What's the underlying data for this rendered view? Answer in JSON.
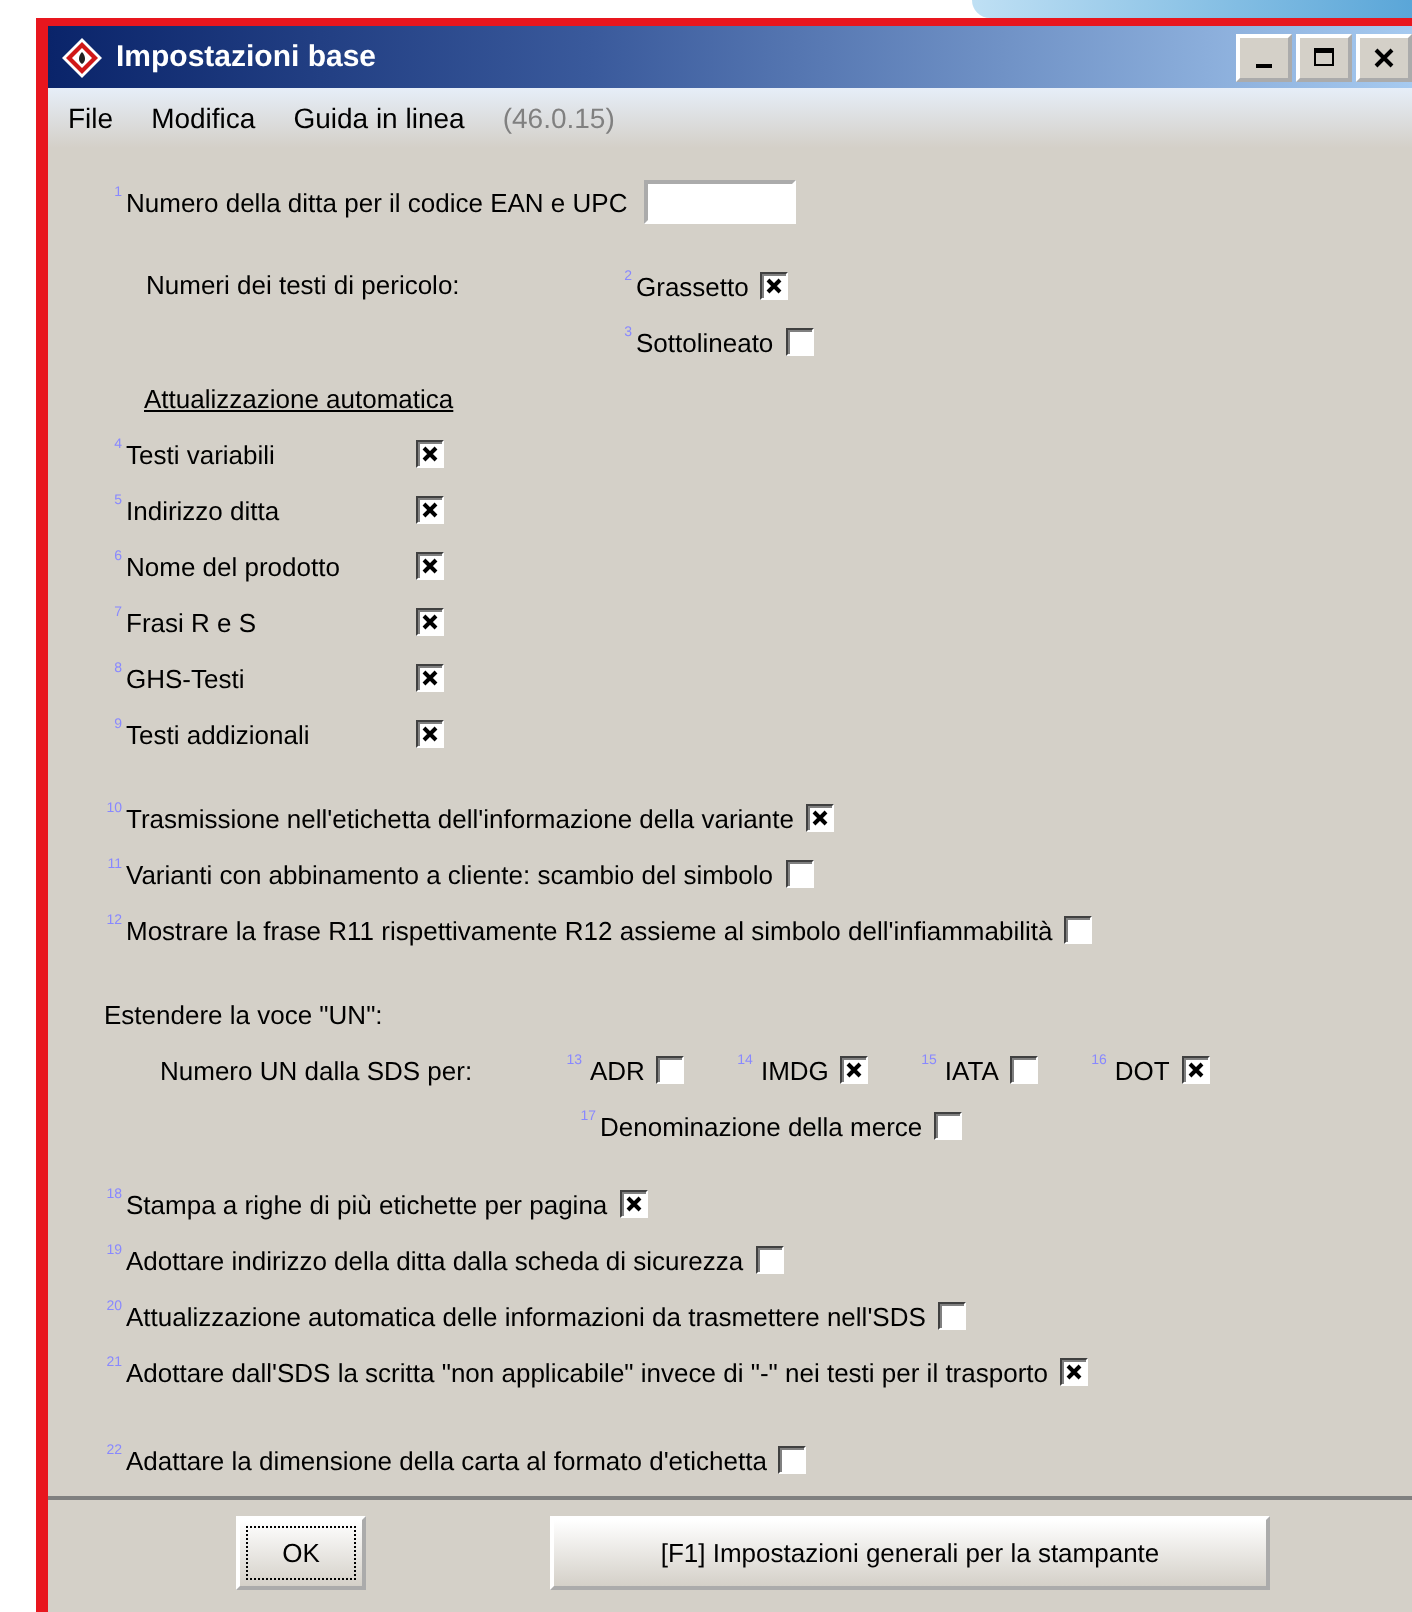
{
  "window": {
    "title": "Impostazioni base"
  },
  "menu": [
    {
      "label": "File"
    },
    {
      "label": "Modifica"
    },
    {
      "label": "Guida in linea"
    }
  ],
  "version": "(46.0.15)",
  "ean": {
    "index": "1",
    "label": "Numero della ditta per il codice EAN e UPC"
  },
  "hazard": {
    "label": "Numeri dei testi di pericolo:",
    "options": [
      {
        "index": "2",
        "label": "Grassetto",
        "checked": true
      },
      {
        "index": "3",
        "label": "Sottolineato",
        "checked": false
      }
    ]
  },
  "auto_update": {
    "heading": "Attualizzazione automatica",
    "items": [
      {
        "index": "4",
        "label": "Testi variabili",
        "checked": true
      },
      {
        "index": "5",
        "label": "Indirizzo ditta",
        "checked": true
      },
      {
        "index": "6",
        "label": "Nome del prodotto",
        "checked": true
      },
      {
        "index": "7",
        "label": "Frasi R e S",
        "checked": true
      },
      {
        "index": "8",
        "label": "GHS-Testi",
        "checked": true
      },
      {
        "index": "9",
        "label": "Testi addizionali",
        "checked": true
      }
    ]
  },
  "options_a": [
    {
      "index": "10",
      "label": "Trasmissione nell'etichetta dell'informazione della variante",
      "checked": true
    },
    {
      "index": "11",
      "label": "Varianti con abbinamento a cliente: scambio del simbolo",
      "checked": false
    },
    {
      "index": "12",
      "label": "Mostrare la frase R11 rispettivamente R12 assieme al simbolo dell'infiammabilità",
      "checked": false
    }
  ],
  "un": {
    "heading": "Estendere la voce \"UN\":",
    "label": "Numero UN dalla SDS per:",
    "options": [
      {
        "index": "13",
        "label": "ADR",
        "checked": false
      },
      {
        "index": "14",
        "label": "IMDG",
        "checked": true
      },
      {
        "index": "15",
        "label": "IATA",
        "checked": false
      },
      {
        "index": "16",
        "label": "DOT",
        "checked": true
      }
    ],
    "extra": {
      "index": "17",
      "label": "Denominazione della merce",
      "checked": false
    }
  },
  "options_b": [
    {
      "index": "18",
      "label": "Stampa a righe di più etichette per pagina",
      "checked": true
    },
    {
      "index": "19",
      "label": "Adottare indirizzo della ditta dalla scheda di sicurezza",
      "checked": false
    },
    {
      "index": "20",
      "label": "Attualizzazione automatica delle informazioni da trasmettere nell'SDS",
      "checked": false
    },
    {
      "index": "21",
      "label": "Adottare dall'SDS la scritta \"non applicabile\" invece di \"-\" nei testi per il trasporto",
      "checked": true
    }
  ],
  "options_c": [
    {
      "index": "22",
      "label": "Adattare la dimensione della carta al formato d'etichetta",
      "checked": false
    }
  ],
  "buttons": [
    {
      "label": "OK",
      "kind": "default"
    },
    {
      "label": "[F1] Impostazioni generali per la stampante",
      "kind": "normal"
    }
  ]
}
